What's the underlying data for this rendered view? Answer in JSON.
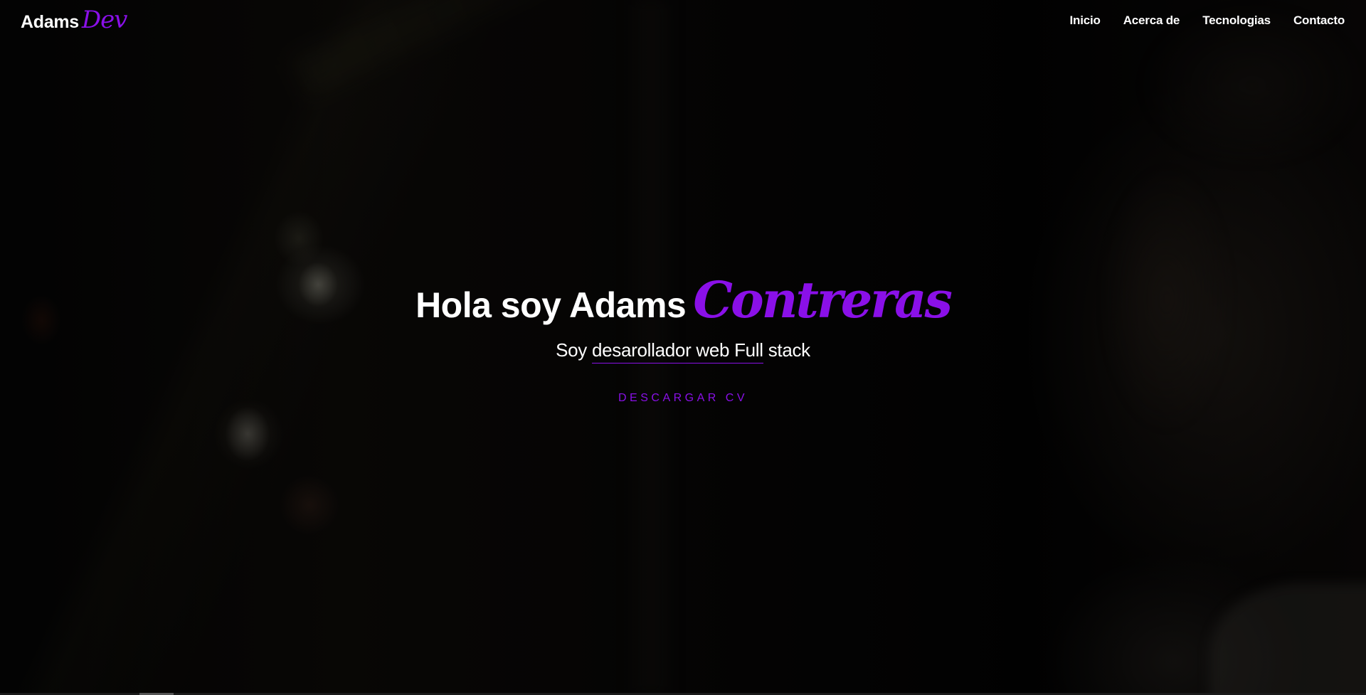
{
  "brand": {
    "main": "Adams",
    "accent": "Dev"
  },
  "nav": {
    "items": [
      {
        "label": "Inicio"
      },
      {
        "label": "Acerca de"
      },
      {
        "label": "Tecnologias"
      },
      {
        "label": "Contacto"
      }
    ]
  },
  "hero": {
    "title_main": "Hola soy Adams",
    "title_accent": "Contreras",
    "subtitle_prefix": "Soy ",
    "subtitle_highlight": "desarollador web Full",
    "subtitle_suffix": " stack",
    "cta_label": "DESCARGAR CV"
  },
  "colors": {
    "accent": "#8a10e8",
    "text": "#ffffff",
    "background": "#000000"
  }
}
